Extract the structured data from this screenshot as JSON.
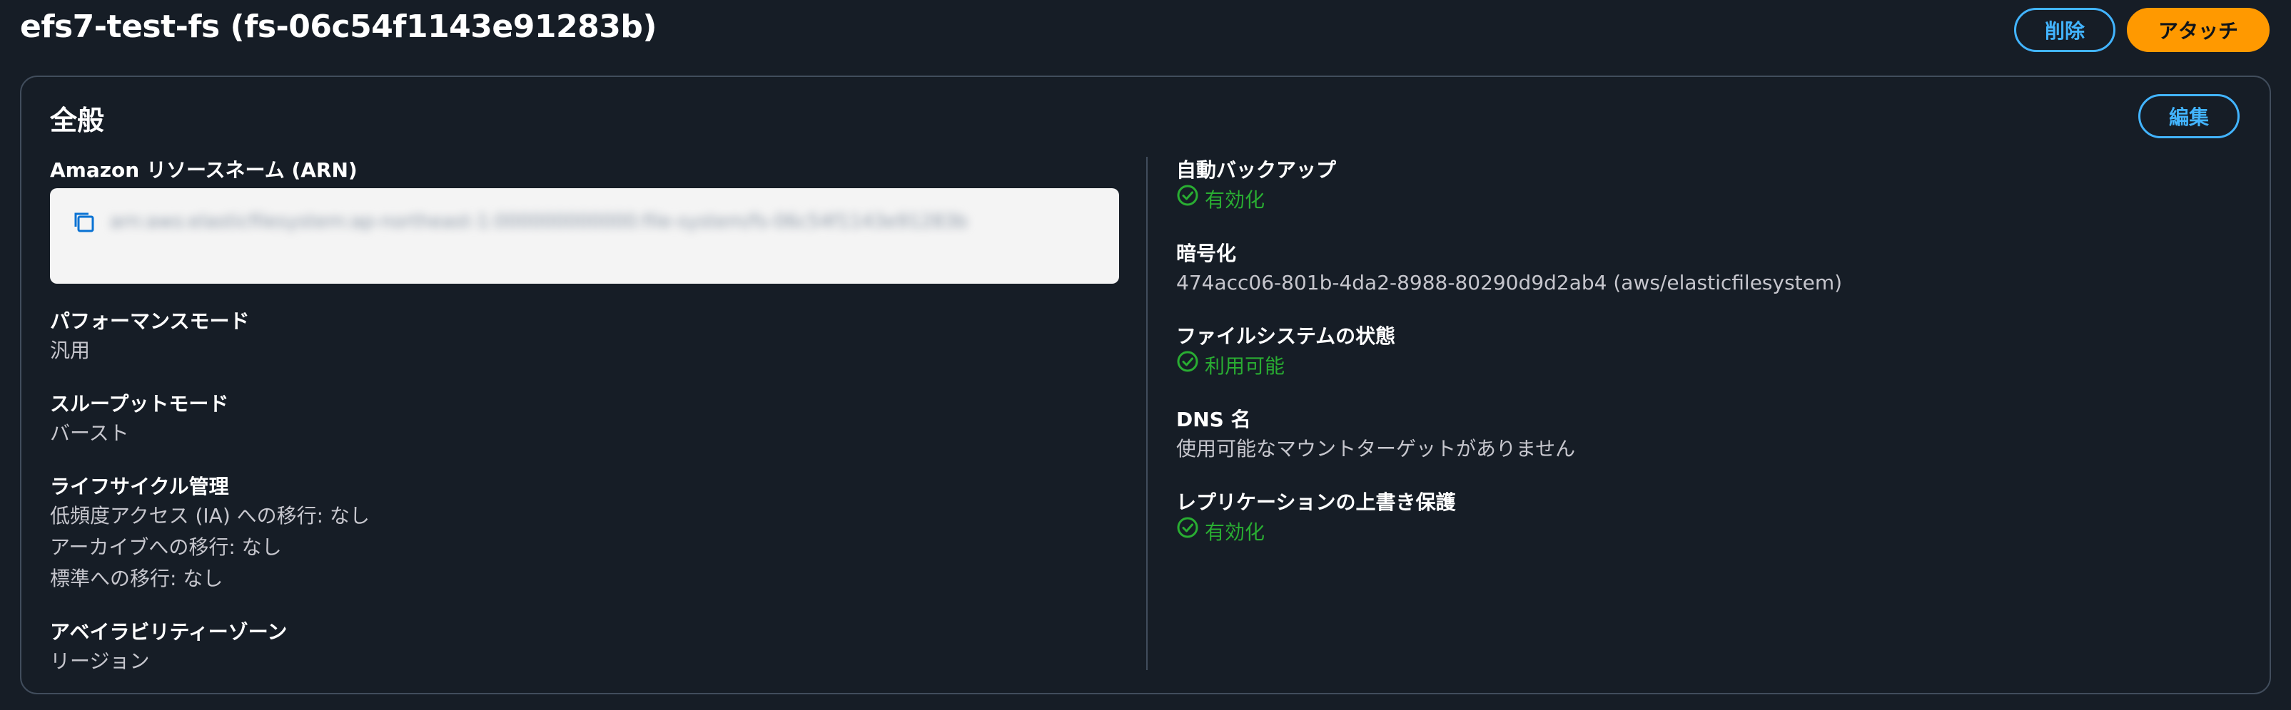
{
  "header": {
    "title": "efs7-test-fs (fs-06c54f1143e91283b)",
    "delete_label": "削除",
    "attach_label": "アタッチ"
  },
  "panel": {
    "title": "全般",
    "edit_label": "編集"
  },
  "left": {
    "arn_label": "Amazon リソースネーム (ARN)",
    "arn_value": "arn:aws:elasticfilesystem:ap-northeast-1:000000000000:file-system/fs-06c54f1143e91283b",
    "performance_label": "パフォーマンスモード",
    "performance_value": "汎用",
    "throughput_label": "スループットモード",
    "throughput_value": "バースト",
    "lifecycle_label": "ライフサイクル管理",
    "lifecycle_lines": [
      "低頻度アクセス (IA) への移行: なし",
      "アーカイブへの移行: なし",
      "標準への移行: なし"
    ],
    "az_label": "アベイラビリティーゾーン",
    "az_value": "リージョン"
  },
  "right": {
    "backup_label": "自動バックアップ",
    "backup_value": "有効化",
    "encryption_label": "暗号化",
    "encryption_value": "474acc06-801b-4da2-8988-80290d9d2ab4 (aws/elasticfilesystem)",
    "state_label": "ファイルシステムの状態",
    "state_value": "利用可能",
    "dns_label": "DNS 名",
    "dns_value": "使用可能なマウントターゲットがありません",
    "replication_label": "レプリケーションの上書き保護",
    "replication_value": "有効化"
  },
  "colors": {
    "background": "#161d26",
    "accent_blue": "#42b4ff",
    "primary_orange": "#ff9900",
    "success_green": "#29ad32",
    "border": "#414d5c"
  },
  "icons": {
    "copy": "copy-icon",
    "status_ok": "check-circle-icon"
  }
}
